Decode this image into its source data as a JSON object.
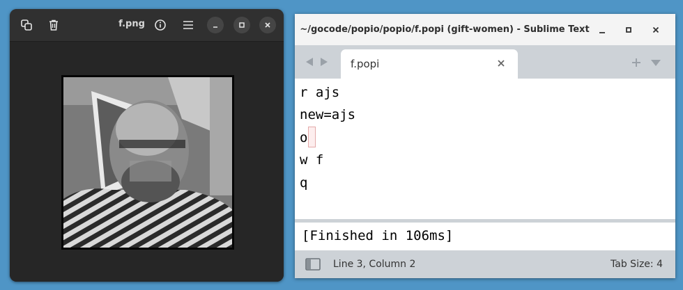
{
  "viewer": {
    "title": "f.png",
    "icons": {
      "copy": "copy-icon",
      "delete": "trash-icon",
      "info": "info-icon",
      "menu": "hamburger-menu-icon",
      "minimize": "minimize-icon",
      "maximize": "maximize-icon",
      "close": "close-icon"
    }
  },
  "sublime": {
    "title": "~/gocode/popio/popio/f.popi (gift-women) - Sublime Text",
    "tab": {
      "label": "f.popi"
    },
    "code_lines": [
      "r ajs",
      "new=ajs",
      "o",
      "w f",
      "q"
    ],
    "output": "[Finished in 106ms]",
    "status": {
      "position": "Line 3, Column 2",
      "tab_size": "Tab Size: 4"
    },
    "colors": {
      "tabbar": "#cdd2d7",
      "cursor_bg": "#fdeeee",
      "cursor_border": "#e3a9a9"
    }
  }
}
